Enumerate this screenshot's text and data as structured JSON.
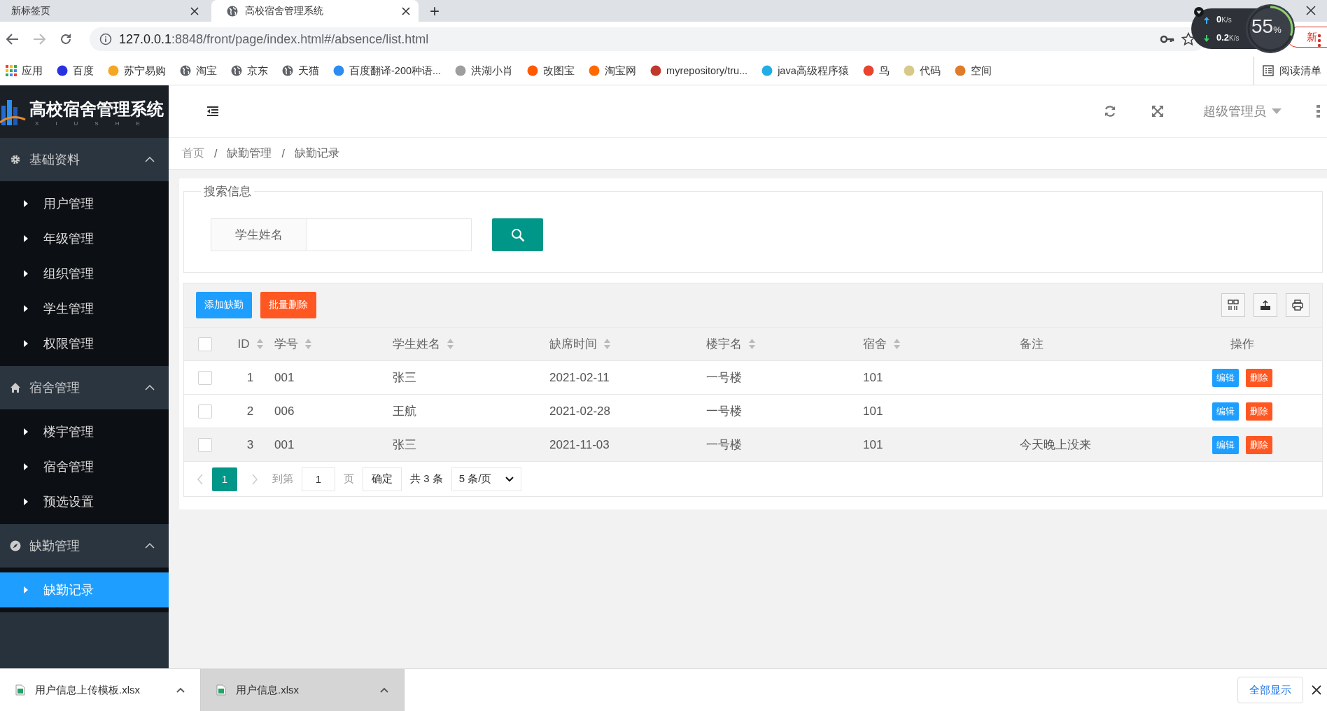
{
  "browser": {
    "tabs": [
      {
        "title": "新标签页",
        "kind": "blank",
        "selected": false
      },
      {
        "title": "高校宿舍管理系统",
        "kind": "site",
        "selected": true
      }
    ],
    "new_tab": "+",
    "url_host": "127.0.0.1",
    "url_rest": ":8848/front/page/index.html#/absence/list.html",
    "update_button": "新",
    "bookmarks": [
      {
        "label": "应用",
        "kind": "apps"
      },
      {
        "label": "百度",
        "kind": "badge",
        "color": "#2932e1"
      },
      {
        "label": "苏宁易购",
        "kind": "badge",
        "color": "#f5a623"
      },
      {
        "label": "淘宝",
        "kind": "globe"
      },
      {
        "label": "京东",
        "kind": "globe"
      },
      {
        "label": "天猫",
        "kind": "globe"
      },
      {
        "label": "百度翻译-200种语...",
        "kind": "badge",
        "color": "#2d8cf0"
      },
      {
        "label": "洪湖小肖",
        "kind": "badge",
        "color": "#9e9e9e"
      },
      {
        "label": "改图宝",
        "kind": "badge",
        "color": "#ff5a00"
      },
      {
        "label": "淘宝网",
        "kind": "badge",
        "color": "#ff6a00"
      },
      {
        "label": "myrepository/tru...",
        "kind": "badge",
        "color": "#c0392b"
      },
      {
        "label": "java高级程序猿",
        "kind": "badge",
        "color": "#23ade5"
      },
      {
        "label": "鸟",
        "kind": "badge",
        "color": "#e8442e"
      },
      {
        "label": "代码",
        "kind": "badge",
        "color": "#d8c98a"
      },
      {
        "label": "空间",
        "kind": "badge",
        "color": "#e07b28"
      }
    ],
    "reading_list": "阅读清单",
    "net_widget": {
      "up": "0",
      "up_unit": "K/s",
      "down": "0.2",
      "down_unit": "K/s",
      "percent": "55",
      "percent_unit": "%"
    }
  },
  "sidebar": {
    "logo_title": "高校宿舍管理系统",
    "logo_subtitle": "XIUSHE",
    "groups": [
      {
        "label": "基础资料",
        "kind": "gear",
        "expanded": true,
        "items": [
          {
            "label": "用户管理",
            "selected": false
          },
          {
            "label": "年级管理",
            "selected": false
          },
          {
            "label": "组织管理",
            "selected": false
          },
          {
            "label": "学生管理",
            "selected": false
          },
          {
            "label": "权限管理",
            "selected": false
          }
        ]
      },
      {
        "label": "宿舍管理",
        "kind": "home",
        "expanded": true,
        "items": [
          {
            "label": "楼宇管理",
            "selected": false
          },
          {
            "label": "宿舍管理",
            "selected": false
          },
          {
            "label": "预选设置",
            "selected": false
          }
        ]
      },
      {
        "label": "缺勤管理",
        "kind": "compass",
        "expanded": true,
        "items": [
          {
            "label": "缺勤记录",
            "selected": true
          }
        ]
      }
    ]
  },
  "header": {
    "user": "超级管理员"
  },
  "breadcrumb": {
    "items": [
      "首页",
      "缺勤管理",
      "缺勤记录"
    ],
    "separator": "/"
  },
  "search": {
    "legend": "搜索信息",
    "label": "学生姓名"
  },
  "toolbar": {
    "buttons": [
      {
        "label": "添加缺勤",
        "kind": "primary"
      },
      {
        "label": "批量删除",
        "kind": "danger"
      }
    ]
  },
  "table": {
    "header_checked": false,
    "columns": [
      {
        "label": "ID",
        "sortable": true
      },
      {
        "label": "学号",
        "sortable": true
      },
      {
        "label": "学生姓名",
        "sortable": true
      },
      {
        "label": "缺席时间",
        "sortable": true
      },
      {
        "label": "楼宇名",
        "sortable": true
      },
      {
        "label": "宿舍",
        "sortable": true
      },
      {
        "label": "备注",
        "sortable": false
      },
      {
        "label": "操作",
        "sortable": false
      }
    ],
    "rows": [
      {
        "checked": false,
        "highlighted": false,
        "cells": [
          "1",
          "001",
          "张三",
          "2021-02-11",
          "一号楼",
          "101"
        ],
        "actions": [
          "编辑",
          "删除"
        ]
      },
      {
        "checked": false,
        "highlighted": false,
        "cells": [
          "2",
          "006",
          "王航",
          "2021-02-28",
          "一号楼",
          "101"
        ],
        "actions": [
          "编辑",
          "删除"
        ]
      },
      {
        "checked": false,
        "highlighted": true,
        "cells": [
          "3",
          "001",
          "张三",
          "2021-11-03",
          "一号楼",
          "101"
        ],
        "note": "今天晚上没来",
        "actions": [
          "编辑",
          "删除"
        ]
      }
    ]
  },
  "pagination": {
    "pages": [
      {
        "label": "1",
        "selected": true
      }
    ],
    "goto_label": "到第",
    "goto_value": "1",
    "page_unit": "页",
    "confirm": "确定",
    "total": "共 3 条",
    "page_size": "5 条/页"
  },
  "downloads": {
    "items": [
      {
        "name": "用户信息上传模板.xlsx",
        "selected": false
      },
      {
        "name": "用户信息.xlsx",
        "selected": true
      }
    ],
    "show_all": "全部显示"
  }
}
